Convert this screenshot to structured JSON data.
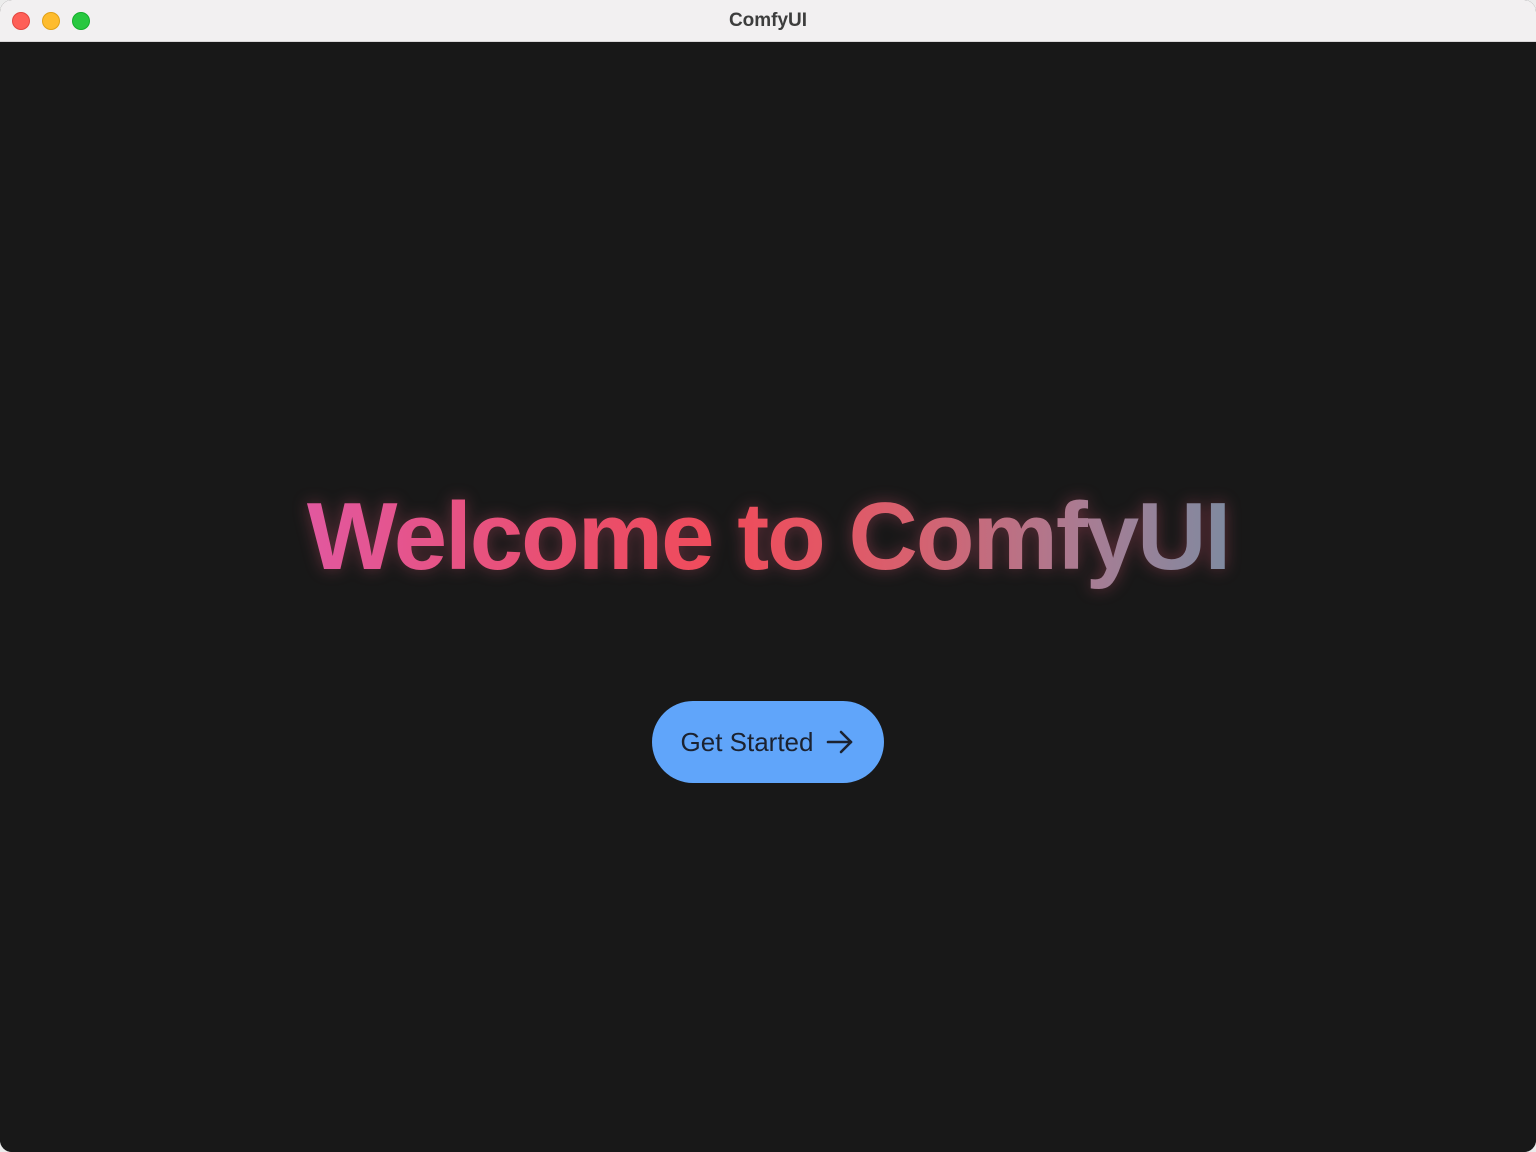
{
  "window": {
    "title": "ComfyUI"
  },
  "welcome": {
    "headline": "Welcome to ComfyUI",
    "button_label": "Get Started",
    "button_icon": "arrow-right-icon"
  },
  "colors": {
    "background": "#181818",
    "button": "#60a5fa",
    "headline_gradient": [
      "#e2589f",
      "#f04b5a",
      "#7f8aa0"
    ]
  }
}
